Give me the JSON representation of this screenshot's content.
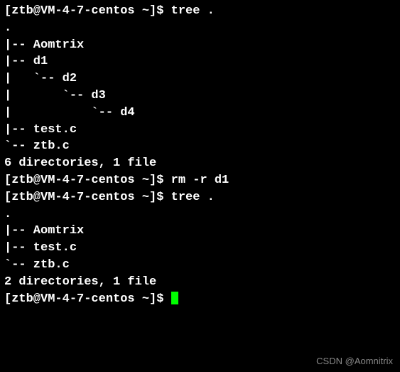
{
  "lines": [
    "[ztb@VM-4-7-centos ~]$ tree .",
    ".",
    "|-- Aomtrix",
    "|-- d1",
    "|   `-- d2",
    "|       `-- d3",
    "|           `-- d4",
    "|-- test.c",
    "`-- ztb.c",
    "",
    "6 directories, 1 file",
    "[ztb@VM-4-7-centos ~]$ rm -r d1",
    "[ztb@VM-4-7-centos ~]$ tree .",
    ".",
    "|-- Aomtrix",
    "|-- test.c",
    "`-- ztb.c",
    "",
    "2 directories, 1 file",
    "[ztb@VM-4-7-centos ~]$ "
  ],
  "watermark": "CSDN @Aomnitrix"
}
